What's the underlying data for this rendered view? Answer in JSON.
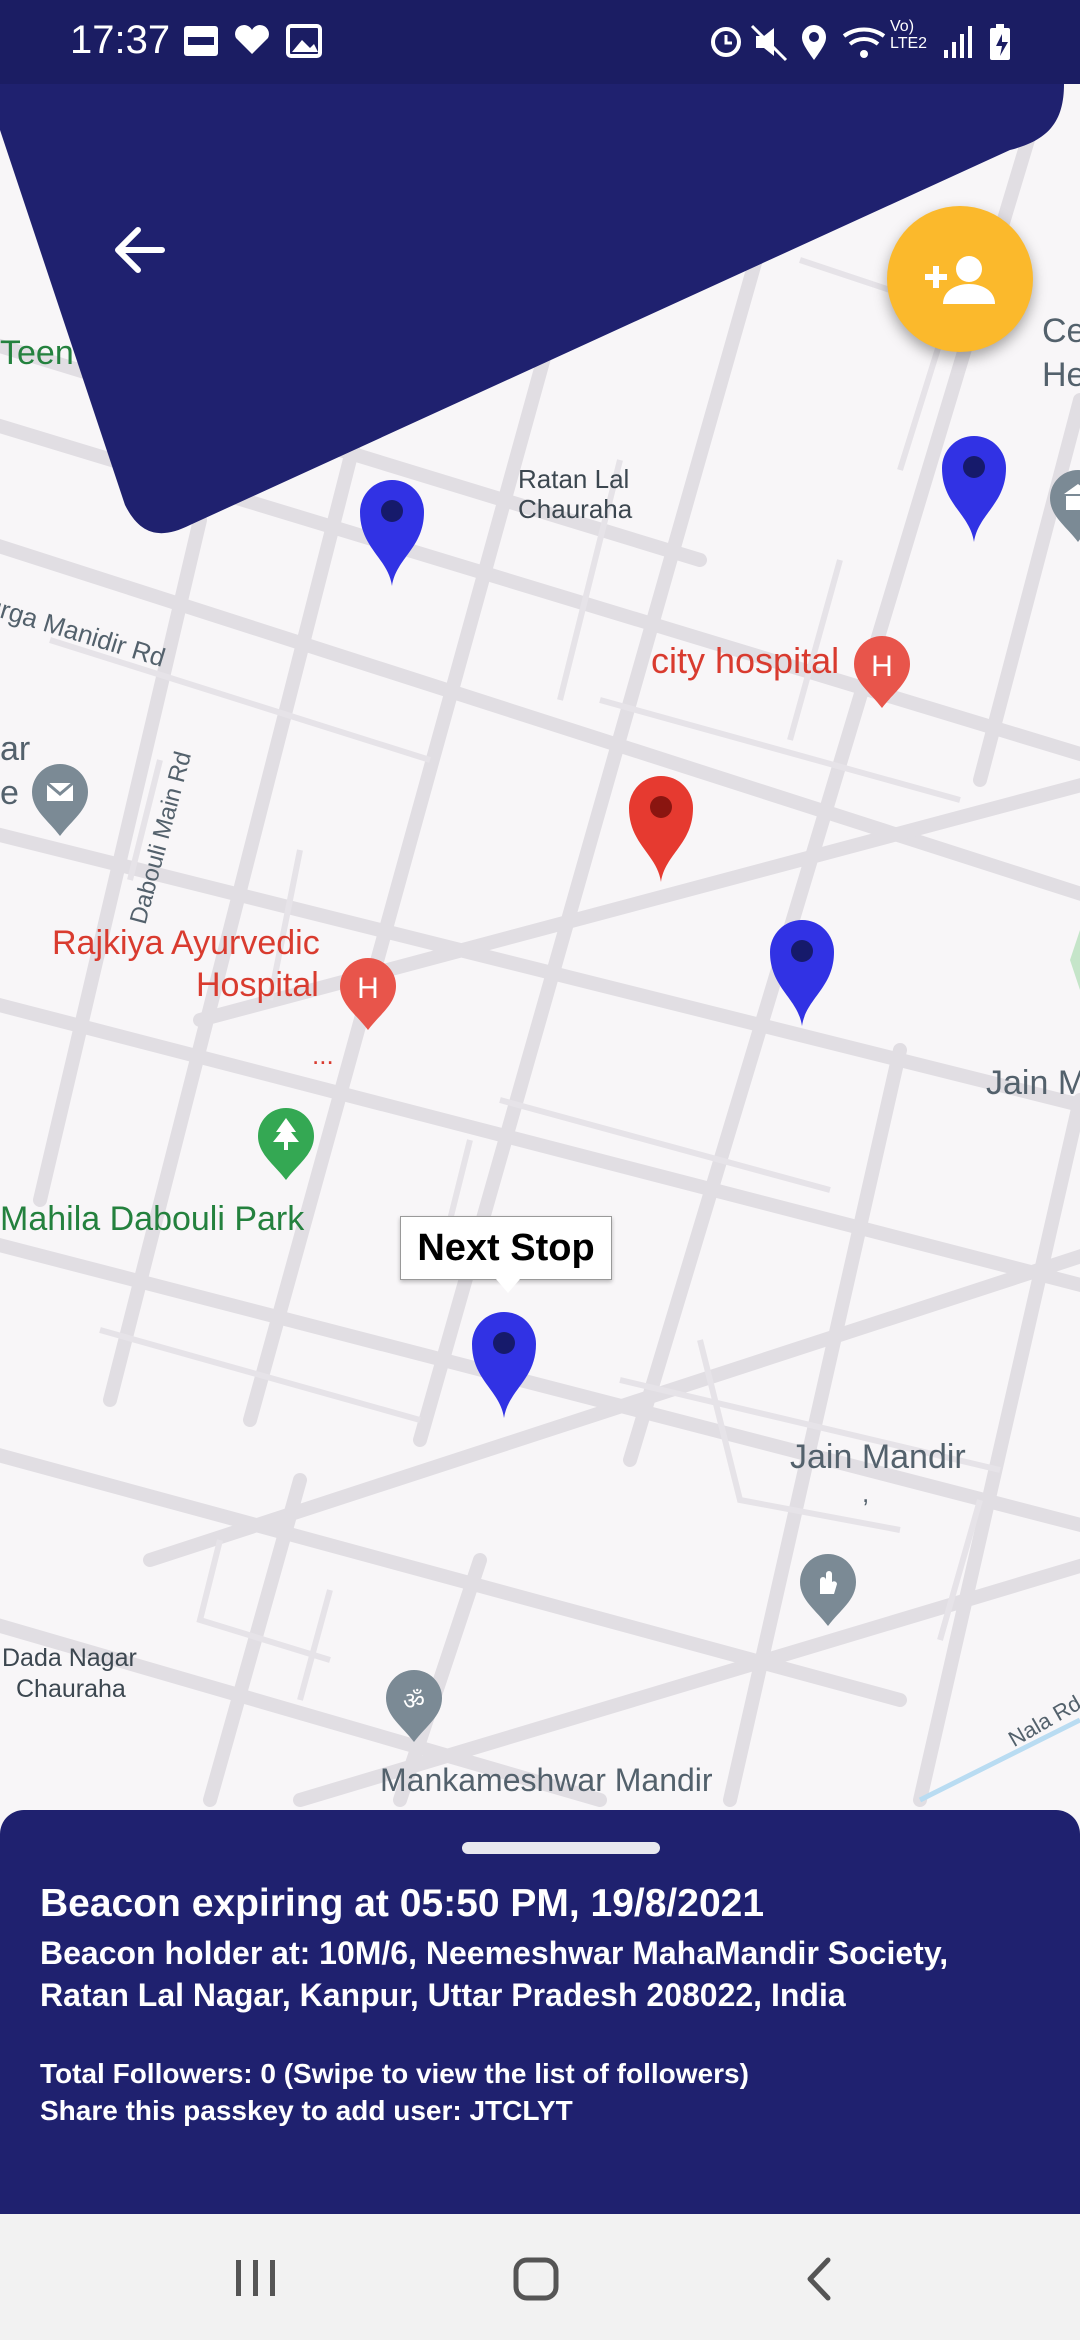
{
  "status_bar": {
    "time": "17:37",
    "left_icons": [
      "paytm-icon",
      "health-icon",
      "gallery-icon"
    ],
    "right_icons": [
      "alarm-icon",
      "mute-icon",
      "location-icon",
      "wifi-icon",
      "volte-icon",
      "signal-icon",
      "battery-icon"
    ],
    "volte_label": "Vo) LTE2"
  },
  "map": {
    "places": {
      "teen": "Teen",
      "ce": "Ce",
      "he": "He",
      "ratan_lal": "Ratan Lal",
      "chauraha": "Chauraha",
      "durga_rd": "urga Manidir Rd",
      "city_hospital": "city hospital",
      "ar": "ar",
      "e": "e",
      "dabouli_main": "Dabouli Main Rd",
      "rajkiya_1": "Rajkiya Ayurvedic",
      "rajkiya_2": "Hospital",
      "ellipsis": "...",
      "jain_m": "Jain M",
      "mahila_park": "Mahila Dabouli Park",
      "jain_mandir": "Jain Mandir",
      "jain_mandir_comma": ",",
      "dada_nagar_1": "Dada Nagar",
      "dada_nagar_2": "Chauraha",
      "mankameshwar": "Mankameshwar Mandir",
      "nala_rd": "Nala Rd"
    },
    "callout": "Next Stop",
    "colors": {
      "follower_pin": "#3132e4",
      "holder_pin": "#e63a30",
      "hospital": "#e8554b",
      "park": "#34a853",
      "temple": "#7b8a95"
    }
  },
  "header": {
    "back_icon": "arrow-back-icon",
    "add_user_icon": "person-add-icon",
    "accent": "#1f216f",
    "fab_color": "#fbb92c"
  },
  "sheet": {
    "expiry": "Beacon expiring at 05:50 PM, 19/8/2021",
    "holder": "Beacon holder at: 10M/6, Neemeshwar MahaMandir Society, Ratan Lal Nagar, Kanpur, Uttar Pradesh 208022, India",
    "followers": "Total Followers: 0 (Swipe to view the list of followers)",
    "passkey": "Share this passkey to add user: JTCLYT"
  },
  "nav": {
    "icons": [
      "recents-icon",
      "home-icon",
      "back-nav-icon"
    ]
  }
}
